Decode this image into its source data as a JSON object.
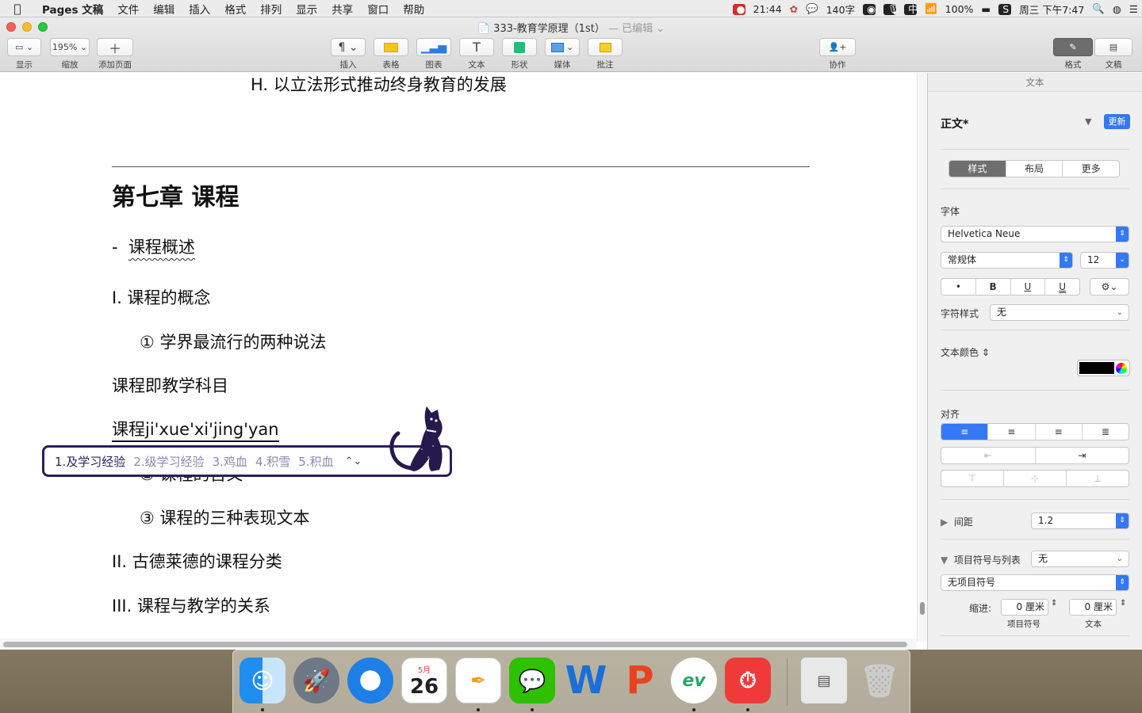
{
  "menubar": {
    "app_name": "Pages 文稿",
    "items": [
      "文件",
      "编辑",
      "插入",
      "格式",
      "排列",
      "显示",
      "共享",
      "窗口",
      "帮助"
    ],
    "time": "21:44",
    "word_count": "140字",
    "battery": "100%",
    "datetime": "周三 下午7:47"
  },
  "window": {
    "title": "333-教育学原理（1st）",
    "edited": "— 已编辑"
  },
  "toolbar": {
    "view_label": "显示",
    "zoom_value": "195%",
    "zoom_label": "缩放",
    "add_page_label": "添加页面",
    "insert_label": "插入",
    "table_label": "表格",
    "chart_label": "图表",
    "text_label": "文本",
    "shape_label": "形状",
    "media_label": "媒体",
    "comment_label": "批注",
    "collaborate_label": "协作",
    "format_label": "格式",
    "document_label": "文稿"
  },
  "document": {
    "line_h": "H.   以立法形式推动终身教育的发展",
    "chapter_title": "第七章 课程",
    "section_prefix": "-",
    "section_title": "课程概述",
    "item_1": "I.     课程的概念",
    "sub_1": "①  学界最流行的两种说法",
    "para_1": "课程即教学科目",
    "para_2": "课程ji'xue'xi'jing'yan",
    "sub_2_partial": "②  课程的含义",
    "sub_3": "③  课程的三种表现文本",
    "item_2": "II.   古德莱德的课程分类",
    "item_3": "III.  课程与教学的关系"
  },
  "ime": {
    "candidates": [
      "1.及学习经验",
      "2.级学习经验",
      "3.鸡血",
      "4.积雪",
      "5.积血"
    ],
    "arrows": "⌃⌄"
  },
  "sidebar": {
    "header": "文本",
    "style_name": "正文*",
    "update_button": "更新",
    "tabs": [
      "样式",
      "布局",
      "更多"
    ],
    "font_label": "字体",
    "font_family": "Helvetica Neue",
    "font_style": "常规体",
    "font_size": "12",
    "format_buttons": [
      "•",
      "B",
      "U",
      "U"
    ],
    "char_style_label": "字符样式",
    "char_style_value": "无",
    "text_color_label": "文本颜色",
    "align_label": "对齐",
    "spacing_label": "间距",
    "spacing_value": "1.2",
    "bullets_label": "项目符号与列表",
    "bullets_value": "无",
    "bullet_type": "无项目符号",
    "indent_label": "缩进:",
    "indent_bullet_value": "0 厘米",
    "indent_bullet_label": "项目符号",
    "indent_text_value": "0 厘米",
    "indent_text_label": "文本"
  },
  "dock": {
    "calendar_month": "5月",
    "calendar_day": "26"
  }
}
